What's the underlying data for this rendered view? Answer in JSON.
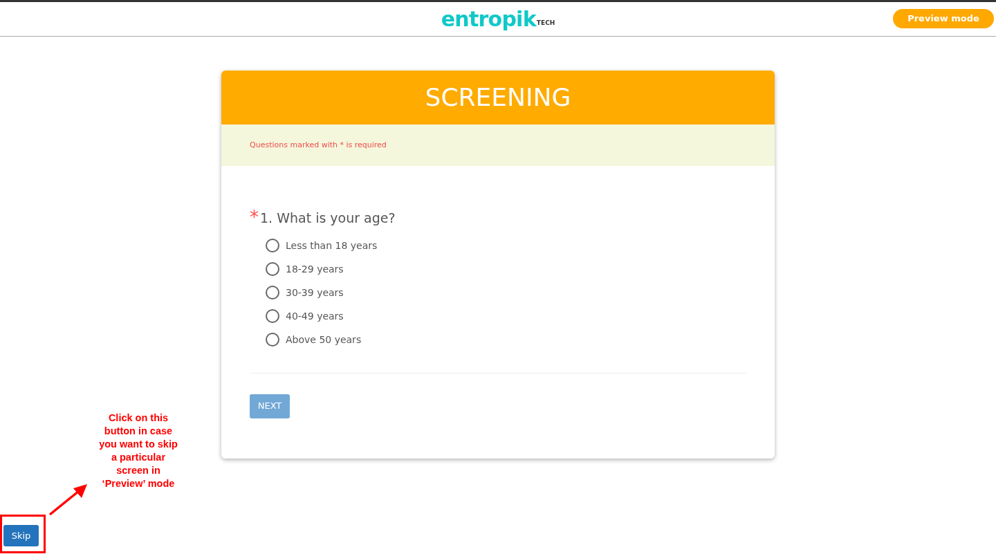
{
  "header": {
    "logo": "entropik",
    "logo_suffix": "TECH",
    "preview_button": "Preview mode"
  },
  "form": {
    "title": "SCREENING",
    "required_note": "Questions marked with * is required",
    "question": {
      "required_mark": "*",
      "text": "1. What is your age?",
      "options": [
        {
          "label": "Less than 18 years",
          "selected": false
        },
        {
          "label": "18-29 years",
          "selected": false
        },
        {
          "label": "30-39 years",
          "selected": false
        },
        {
          "label": "40-49 years",
          "selected": false
        },
        {
          "label": "Above 50 years",
          "selected": false
        }
      ]
    },
    "next_button": "NEXT"
  },
  "skip_button": "Skip",
  "annotation": {
    "text": "Click on this button in case you want to skip a particular screen in ‘Preview’ mode"
  }
}
